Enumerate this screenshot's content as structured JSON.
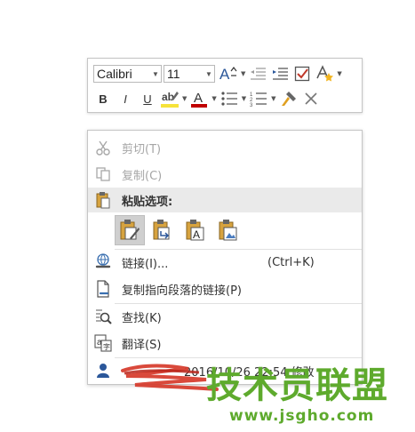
{
  "mini_toolbar": {
    "font_name": "Calibri",
    "font_size": "11",
    "bold": "B",
    "italic": "I",
    "underline": "U",
    "font_color_letter": "A",
    "highlight_color": "#f6e33a",
    "font_color": "#c00000"
  },
  "context_menu": {
    "cut": "剪切(T)",
    "copy": "复制(C)",
    "paste_options": "粘贴选项:",
    "link": "链接(I)...",
    "link_shortcut": "(Ctrl+K)",
    "copy_paragraph_link": "复制指向段落的链接(P)",
    "find": "查找(K)",
    "translate": "翻译(S)",
    "author_info": "2016/10/26 22:54 修改"
  },
  "watermark": {
    "title": "技术员联盟",
    "url": "www.jsgho.com"
  },
  "icons": {
    "cut": "scissors-icon",
    "copy": "copy-icon",
    "paste": "clipboard-icon",
    "link": "link-icon",
    "copy_link": "document-link-icon",
    "find": "find-icon",
    "translate": "translate-icon",
    "author": "person-icon"
  }
}
